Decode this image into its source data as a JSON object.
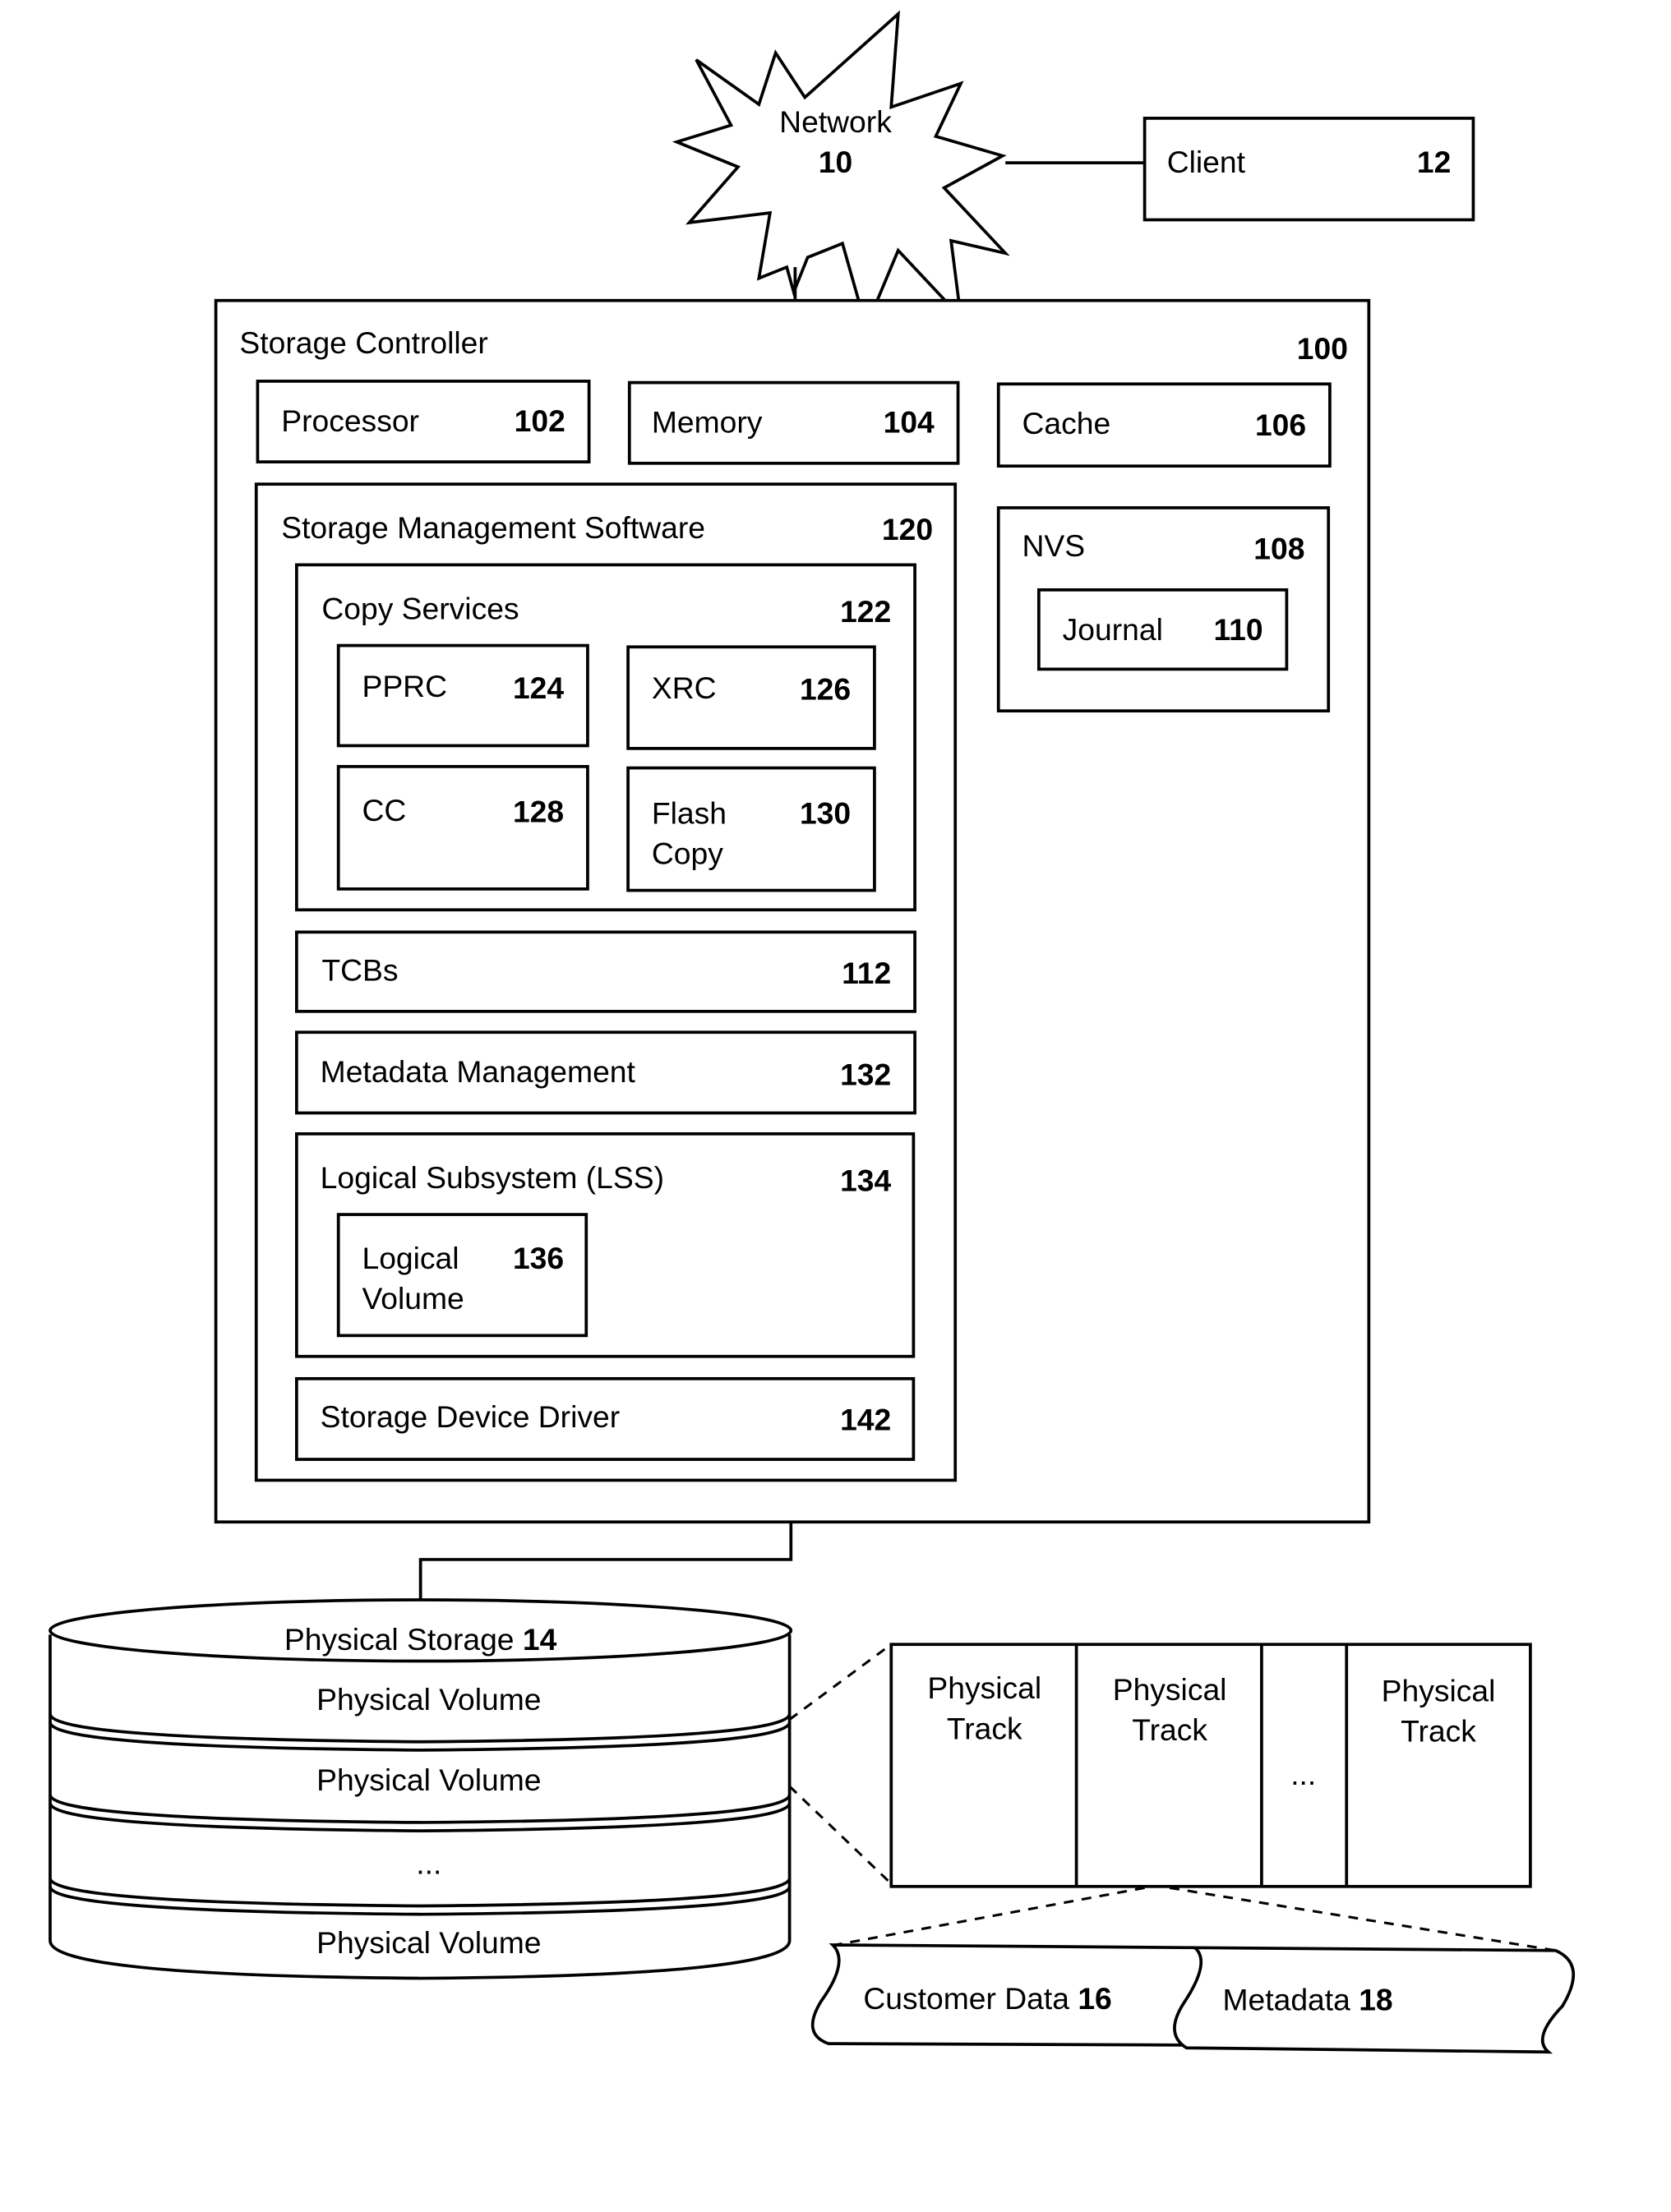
{
  "network": {
    "label": "Network",
    "number": "10"
  },
  "client": {
    "label": "Client",
    "number": "12"
  },
  "storage_controller": {
    "label": "Storage Controller",
    "number": "100",
    "processor": {
      "label": "Processor",
      "number": "102"
    },
    "memory": {
      "label": "Memory",
      "number": "104"
    },
    "cache": {
      "label": "Cache",
      "number": "106"
    },
    "nvs": {
      "label": "NVS",
      "number": "108",
      "journal": {
        "label": "Journal",
        "number": "110"
      }
    },
    "storage_management_software": {
      "label": "Storage Management Software",
      "number": "120",
      "copy_services": {
        "label": "Copy Services",
        "number": "122",
        "pprc": {
          "label": "PPRC",
          "number": "124"
        },
        "xrc": {
          "label": "XRC",
          "number": "126"
        },
        "cc": {
          "label": "CC",
          "number": "128"
        },
        "flash_copy": {
          "label_line1": "Flash",
          "label_line2": "Copy",
          "number": "130"
        }
      },
      "tcbs": {
        "label": "TCBs",
        "number": "112"
      },
      "metadata_management": {
        "label": "Metadata Management",
        "number": "132"
      },
      "lss": {
        "label": "Logical Subsystem (LSS)",
        "number": "134",
        "logical_volume": {
          "label_line1": "Logical",
          "label_line2": "Volume",
          "number": "136"
        }
      },
      "storage_device_driver": {
        "label": "Storage Device Driver",
        "number": "142"
      }
    }
  },
  "physical_storage": {
    "label": "Physical Storage",
    "number": "14",
    "volumes": [
      "Physical Volume",
      "Physical Volume",
      "...",
      "Physical Volume"
    ]
  },
  "tracks": {
    "items": [
      {
        "line1": "Physical",
        "line2": "Track"
      },
      {
        "line1": "Physical",
        "line2": "Track"
      },
      {
        "line1": "...",
        "line2": ""
      },
      {
        "line1": "Physical",
        "line2": "Track"
      }
    ]
  },
  "track_contents": {
    "customer_data": {
      "label": "Customer Data",
      "number": "16"
    },
    "metadata": {
      "label": "Metadata",
      "number": "18"
    }
  }
}
